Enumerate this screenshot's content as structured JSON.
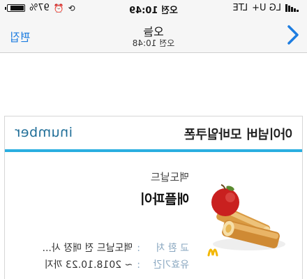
{
  "status_bar": {
    "carrier": "LG U+",
    "network": "LTE",
    "time": "오전 10:49",
    "battery_percent": "97%",
    "battery_level": 0.97,
    "icons": [
      "signal-icon",
      "alarm-icon",
      "rotation-lock-icon",
      "battery-icon"
    ]
  },
  "nav": {
    "title": "오늘",
    "subtitle": "오전 10:48",
    "edit_label": "편집",
    "back_icon": "chevron-left-icon",
    "accent_color": "#1e7de0"
  },
  "coupon": {
    "title": "아이넘버 모바일쿠폰",
    "brand_logo": "inumber",
    "brand": "맥도날드",
    "product": "애플파이",
    "place_label": "교 환 처",
    "place_value": "맥도날드 전 매장 사...",
    "expiry_label": "유효기간",
    "expiry_value": "~ 2018.10.23 까지",
    "stripe_color": "#2aaee0",
    "image": "apple-pie-product-image"
  }
}
